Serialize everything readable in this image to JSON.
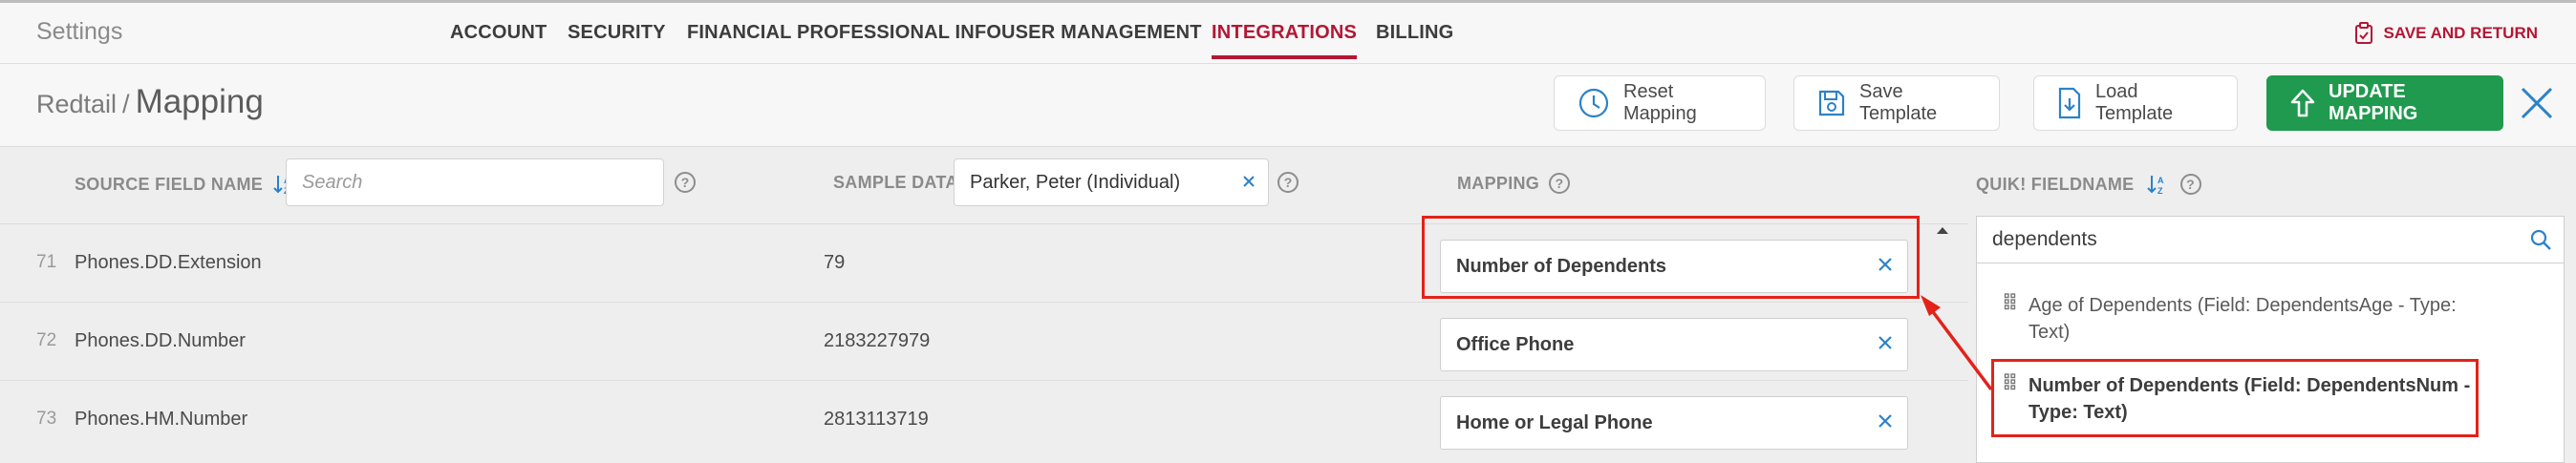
{
  "app": {
    "title": "Settings"
  },
  "nav": {
    "tabs": [
      {
        "label": "ACCOUNT",
        "active": false
      },
      {
        "label": "SECURITY",
        "active": false
      },
      {
        "label": "FINANCIAL PROFESSIONAL INFO",
        "active": false
      },
      {
        "label": "USER MANAGEMENT",
        "active": false
      },
      {
        "label": "INTEGRATIONS",
        "active": true
      },
      {
        "label": "BILLING",
        "active": false
      }
    ],
    "save_return": "SAVE AND RETURN"
  },
  "header": {
    "breadcrumb_root": "Redtail",
    "breadcrumb_sep": "/",
    "breadcrumb_current": "Mapping",
    "reset_label": "Reset Mapping",
    "save_template_label": "Save Template",
    "load_template_label": "Load Template",
    "update_label": "UPDATE MAPPING"
  },
  "columns": {
    "source_field": "SOURCE FIELD NAME",
    "source_search_placeholder": "Search",
    "sample_data": "SAMPLE DATA",
    "sample_value": "Parker, Peter (Individual)",
    "mapping": "MAPPING",
    "help_glyph": "?"
  },
  "rows": [
    {
      "num": "71",
      "source": "Phones.DD.Extension",
      "sample": "79",
      "mapping": "Number of Dependents"
    },
    {
      "num": "72",
      "source": "Phones.DD.Number",
      "sample": "2183227979",
      "mapping": "Office Phone"
    },
    {
      "num": "73",
      "source": "Phones.HM.Number",
      "sample": "2813113719",
      "mapping": "Home or Legal Phone"
    }
  ],
  "right_panel": {
    "label": "QUIK! FIELDNAME",
    "search_value": "dependents",
    "results": [
      "Age of Dependents (Field: DependentsAge - Type: Text)",
      "Number of Dependents (Field: DependentsNum - Type: Text)"
    ]
  },
  "colors": {
    "accent_red": "#b31734",
    "primary_green": "#1f9a4e",
    "link_blue": "#2b82c9",
    "highlight_red": "#e32219"
  },
  "icons": [
    "clipboard-check-icon",
    "clock-icon",
    "save-icon",
    "file-download-icon",
    "upload-arrow-icon",
    "close-icon",
    "sort-az-icon",
    "help-icon",
    "clear-icon",
    "search-icon",
    "drag-handle-icon",
    "caret-up-icon",
    "arrow-annotation"
  ]
}
